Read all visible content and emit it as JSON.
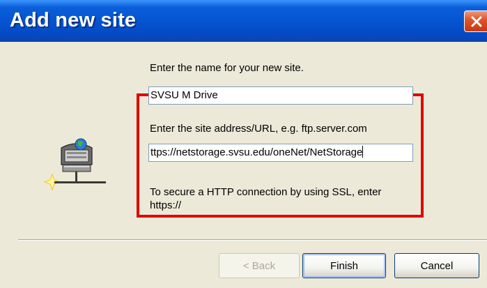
{
  "dialog": {
    "title": "Add new site",
    "icon": "network-site-icon"
  },
  "form": {
    "name_label": "Enter the name for your new site.",
    "name_value": "SVSU M Drive",
    "url_label": "Enter the site address/URL, e.g. ftp.server.com",
    "url_value": "ttps://netstorage.svsu.edu/oneNet/NetStorage",
    "hint": "To secure a HTTP connection by using SSL, enter https://"
  },
  "buttons": {
    "back": "< Back",
    "finish": "Finish",
    "cancel": "Cancel"
  },
  "colors": {
    "highlight_border": "#e00000",
    "title_bar": "#0553d0",
    "close_button": "#e0572c"
  }
}
